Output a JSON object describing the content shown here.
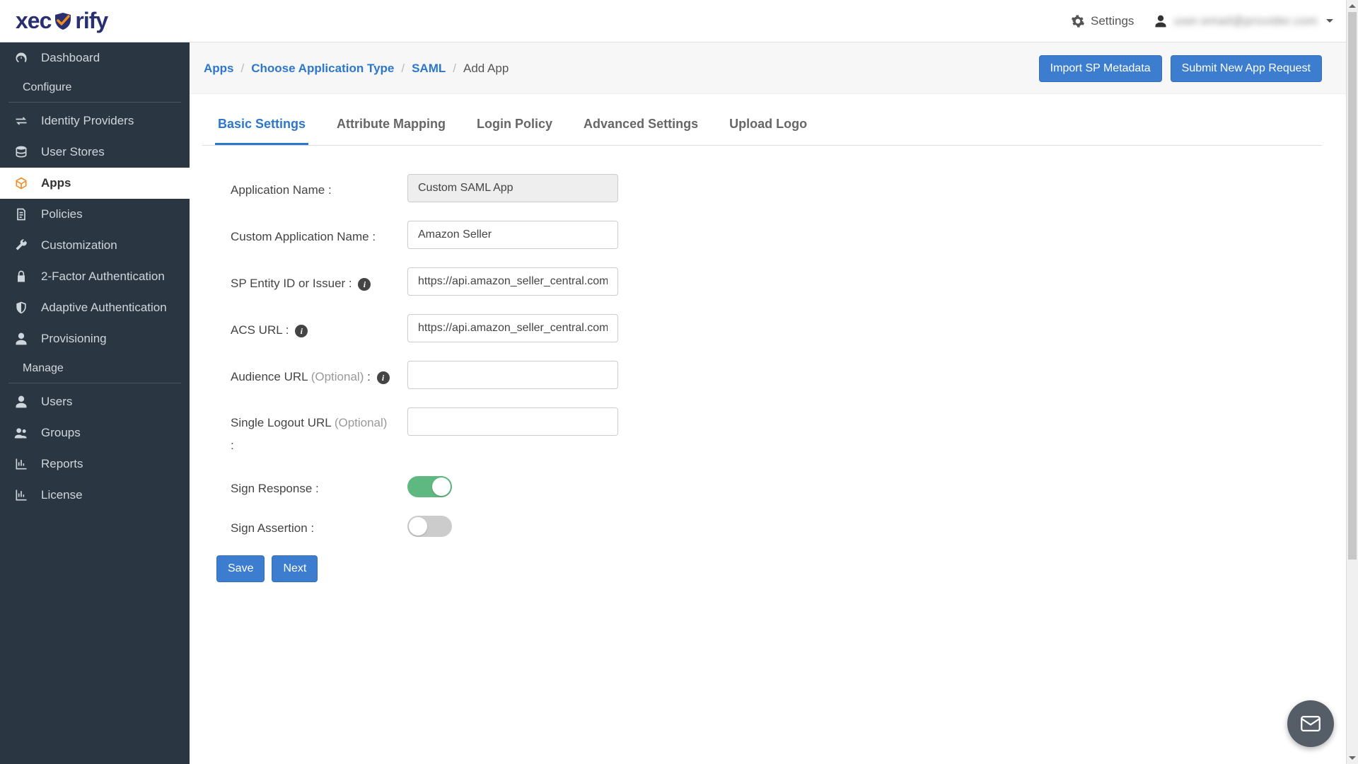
{
  "header": {
    "logo_left": "xec",
    "logo_right": "rify",
    "settings_label": "Settings",
    "user_label": "user.email@provider.com"
  },
  "sidebar": {
    "items_top": [
      {
        "id": "dashboard",
        "label": "Dashboard",
        "icon": "dashboard-icon"
      }
    ],
    "section_configure": "Configure",
    "items_configure": [
      {
        "id": "identity-providers",
        "label": "Identity Providers",
        "icon": "swap-icon"
      },
      {
        "id": "user-stores",
        "label": "User Stores",
        "icon": "stack-icon"
      },
      {
        "id": "apps",
        "label": "Apps",
        "icon": "cube-icon",
        "active": true
      },
      {
        "id": "policies",
        "label": "Policies",
        "icon": "document-icon"
      },
      {
        "id": "customization",
        "label": "Customization",
        "icon": "wrench-icon"
      },
      {
        "id": "2fa",
        "label": "2-Factor Authentication",
        "icon": "lock-icon"
      },
      {
        "id": "adaptive-auth",
        "label": "Adaptive Authentication",
        "icon": "shield-icon"
      },
      {
        "id": "provisioning",
        "label": "Provisioning",
        "icon": "user-icon"
      }
    ],
    "section_manage": "Manage",
    "items_manage": [
      {
        "id": "users",
        "label": "Users",
        "icon": "user-icon"
      },
      {
        "id": "groups",
        "label": "Groups",
        "icon": "users-icon"
      },
      {
        "id": "reports",
        "label": "Reports",
        "icon": "chart-icon"
      },
      {
        "id": "license",
        "label": "License",
        "icon": "chart-icon"
      }
    ]
  },
  "breadcrumb": {
    "items": [
      {
        "label": "Apps",
        "link": true
      },
      {
        "label": "Choose Application Type",
        "link": true
      },
      {
        "label": "SAML",
        "link": true
      },
      {
        "label": "Add App",
        "link": false
      }
    ]
  },
  "buttons": {
    "import_sp_metadata": "Import SP Metadata",
    "submit_new_app_request": "Submit New App Request",
    "save": "Save",
    "next": "Next"
  },
  "tabs": [
    {
      "id": "basic",
      "label": "Basic Settings",
      "active": true
    },
    {
      "id": "attribute",
      "label": "Attribute Mapping"
    },
    {
      "id": "login",
      "label": "Login Policy"
    },
    {
      "id": "advanced",
      "label": "Advanced Settings"
    },
    {
      "id": "logo",
      "label": "Upload Logo"
    }
  ],
  "form": {
    "app_name_label": "Application Name :",
    "app_name_value": "Custom SAML App",
    "custom_app_name_label": "Custom Application Name :",
    "custom_app_name_value": "Amazon Seller",
    "sp_entity_label": "SP Entity ID or Issuer :",
    "sp_entity_value": "https://api.amazon_seller_central.com",
    "acs_url_label": "ACS URL :",
    "acs_url_value": "https://api.amazon_seller_central.com",
    "audience_url_label": "Audience URL ",
    "audience_url_optional": "(Optional)",
    "audience_url_suffix": " :",
    "audience_url_value": "",
    "slo_url_label": "Single Logout URL ",
    "slo_url_optional": "(Optional)",
    "slo_url_suffix": " :",
    "slo_url_value": "",
    "sign_response_label": "Sign Response :",
    "sign_response_on": true,
    "sign_assertion_label": "Sign Assertion :",
    "sign_assertion_on": false
  }
}
